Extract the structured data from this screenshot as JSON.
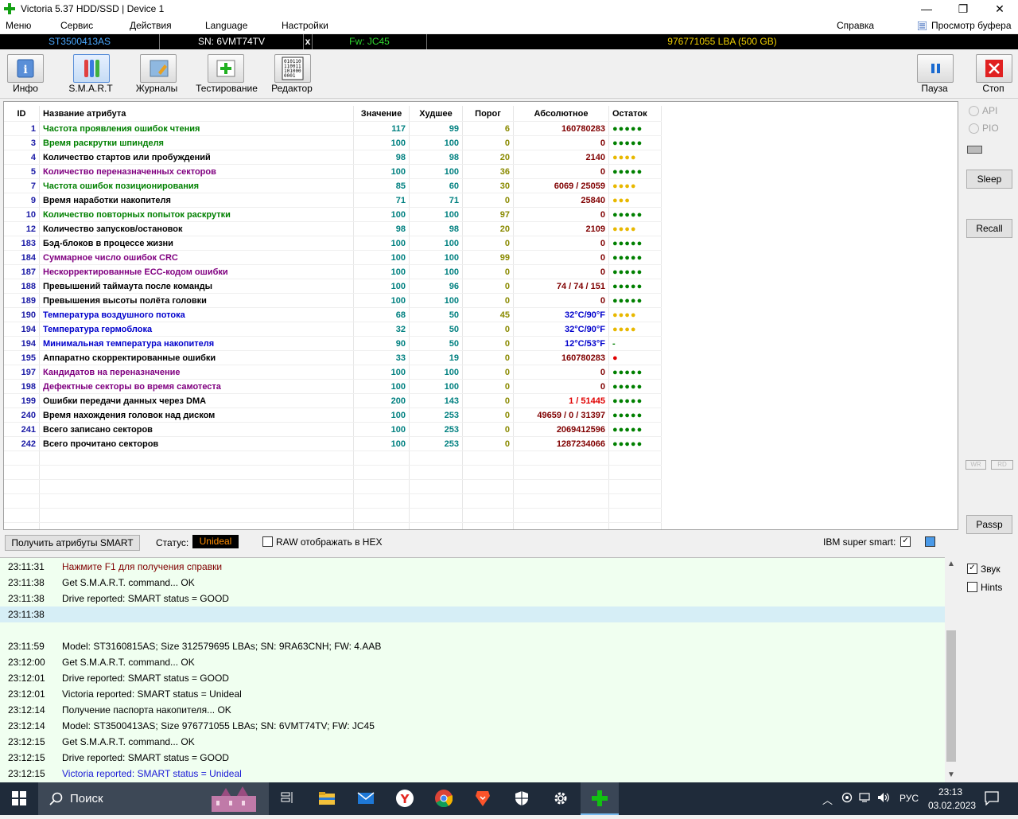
{
  "window": {
    "title": "Victoria 5.37 HDD/SSD | Device 1",
    "minimize": "—",
    "maximize": "❐",
    "close": "✕"
  },
  "menu": {
    "items": [
      "Меню",
      "Сервис",
      "Действия",
      "Language",
      "Настройки"
    ],
    "help": "Справка",
    "buffer": "Просмотр буфера"
  },
  "drive": {
    "model": "ST3500413AS",
    "serial": "SN: 6VMT74TV",
    "close": "x",
    "firmware": "Fw: JC45",
    "capacity": "976771055 LBA (500 GB)"
  },
  "toolbar": {
    "info": "Инфо",
    "smart": "S.M.A.R.T",
    "logs": "Журналы",
    "test": "Тестирование",
    "editor": "Редактор",
    "pause": "Пауза",
    "stop": "Стоп"
  },
  "table": {
    "headers": {
      "id": "ID",
      "name": "Название атрибута",
      "value": "Значение",
      "worst": "Худшее",
      "threshold": "Порог",
      "raw": "Абсолютное",
      "remain": "Остаток"
    },
    "rows": [
      {
        "id": "1",
        "name": "Частота проявления ошибок чтения",
        "value": "117",
        "worst": "99",
        "threshold": "6",
        "raw": "160780283",
        "remain": "●●●●●",
        "nameColor": "#008000",
        "remainColor": "#008000"
      },
      {
        "id": "3",
        "name": "Время раскрутки шпинделя",
        "value": "100",
        "worst": "100",
        "threshold": "0",
        "raw": "0",
        "remain": "●●●●●",
        "nameColor": "#008000",
        "remainColor": "#008000"
      },
      {
        "id": "4",
        "name": "Количество стартов или пробуждений",
        "value": "98",
        "worst": "98",
        "threshold": "20",
        "raw": "2140",
        "remain": "●●●●",
        "nameColor": "#000000",
        "remainColor": "#e8b800"
      },
      {
        "id": "5",
        "name": "Количество переназначенных секторов",
        "value": "100",
        "worst": "100",
        "threshold": "36",
        "raw": "0",
        "remain": "●●●●●",
        "nameColor": "#800080",
        "remainColor": "#008000"
      },
      {
        "id": "7",
        "name": "Частота ошибок позиционирования",
        "value": "85",
        "worst": "60",
        "threshold": "30",
        "raw": "6069 / 25059",
        "remain": "●●●●",
        "nameColor": "#008000",
        "remainColor": "#e8b800"
      },
      {
        "id": "9",
        "name": "Время наработки накопителя",
        "value": "71",
        "worst": "71",
        "threshold": "0",
        "raw": "25840",
        "remain": "●●●",
        "nameColor": "#000000",
        "remainColor": "#e8b800"
      },
      {
        "id": "10",
        "name": "Количество повторных попыток раскрутки",
        "value": "100",
        "worst": "100",
        "threshold": "97",
        "raw": "0",
        "remain": "●●●●●",
        "nameColor": "#008000",
        "remainColor": "#008000"
      },
      {
        "id": "12",
        "name": "Количество запусков/остановок",
        "value": "98",
        "worst": "98",
        "threshold": "20",
        "raw": "2109",
        "remain": "●●●●",
        "nameColor": "#000000",
        "remainColor": "#e8b800"
      },
      {
        "id": "183",
        "name": "Бэд-блоков в процессе жизни",
        "value": "100",
        "worst": "100",
        "threshold": "0",
        "raw": "0",
        "remain": "●●●●●",
        "nameColor": "#000000",
        "remainColor": "#008000"
      },
      {
        "id": "184",
        "name": "Суммарное число ошибок CRC",
        "value": "100",
        "worst": "100",
        "threshold": "99",
        "raw": "0",
        "remain": "●●●●●",
        "nameColor": "#800080",
        "remainColor": "#008000"
      },
      {
        "id": "187",
        "name": "Нескорректированные ECC-кодом ошибки",
        "value": "100",
        "worst": "100",
        "threshold": "0",
        "raw": "0",
        "remain": "●●●●●",
        "nameColor": "#800080",
        "remainColor": "#008000"
      },
      {
        "id": "188",
        "name": "Превышений таймаута после команды",
        "value": "100",
        "worst": "96",
        "threshold": "0",
        "raw": "74 / 74 / 151",
        "remain": "●●●●●",
        "nameColor": "#000000",
        "remainColor": "#008000"
      },
      {
        "id": "189",
        "name": "Превышения высоты полёта головки",
        "value": "100",
        "worst": "100",
        "threshold": "0",
        "raw": "0",
        "remain": "●●●●●",
        "nameColor": "#000000",
        "remainColor": "#008000"
      },
      {
        "id": "190",
        "name": "Температура воздушного потока",
        "value": "68",
        "worst": "50",
        "threshold": "45",
        "raw": "32°C/90°F",
        "remain": "●●●●",
        "nameColor": "#0000cc",
        "remainColor": "#e8b800",
        "rawColor": "#0000cc"
      },
      {
        "id": "194",
        "name": "Температура гермоблока",
        "value": "32",
        "worst": "50",
        "threshold": "0",
        "raw": "32°C/90°F",
        "remain": "●●●●",
        "nameColor": "#0000cc",
        "remainColor": "#e8b800",
        "rawColor": "#0000cc"
      },
      {
        "id": "194",
        "name": "Минимальная температура накопителя",
        "value": "90",
        "worst": "50",
        "threshold": "0",
        "raw": "12°C/53°F",
        "remain": "-",
        "nameColor": "#0000cc",
        "remainColor": "#008000",
        "rawColor": "#0000cc"
      },
      {
        "id": "195",
        "name": "Аппаратно скорректированные ошибки",
        "value": "33",
        "worst": "19",
        "threshold": "0",
        "raw": "160780283",
        "remain": "●",
        "nameColor": "#000000",
        "remainColor": "#e00000"
      },
      {
        "id": "197",
        "name": "Кандидатов на переназначение",
        "value": "100",
        "worst": "100",
        "threshold": "0",
        "raw": "0",
        "remain": "●●●●●",
        "nameColor": "#800080",
        "remainColor": "#008000"
      },
      {
        "id": "198",
        "name": "Дефектные секторы во время самотеста",
        "value": "100",
        "worst": "100",
        "threshold": "0",
        "raw": "0",
        "remain": "●●●●●",
        "nameColor": "#800080",
        "remainColor": "#008000"
      },
      {
        "id": "199",
        "name": "Ошибки передачи данных через DMA",
        "value": "200",
        "worst": "143",
        "threshold": "0",
        "raw": "1 / 51445",
        "remain": "●●●●●",
        "nameColor": "#000000",
        "remainColor": "#008000",
        "rawColor": "#e00000"
      },
      {
        "id": "240",
        "name": "Время нахождения головок над диском",
        "value": "100",
        "worst": "253",
        "threshold": "0",
        "raw": "49659 / 0 / 31397",
        "remain": "●●●●●",
        "nameColor": "#000000",
        "remainColor": "#008000"
      },
      {
        "id": "241",
        "name": "Всего записано секторов",
        "value": "100",
        "worst": "253",
        "threshold": "0",
        "raw": "2069412596",
        "remain": "●●●●●",
        "nameColor": "#000000",
        "remainColor": "#008000"
      },
      {
        "id": "242",
        "name": "Всего прочитано секторов",
        "value": "100",
        "worst": "253",
        "threshold": "0",
        "raw": "1287234066",
        "remain": "●●●●●",
        "nameColor": "#000000",
        "remainColor": "#008000"
      }
    ]
  },
  "rightpanel": {
    "api": "API",
    "pio": "PIO",
    "sleep": "Sleep",
    "recall": "Recall",
    "wr": "WR",
    "rd": "RD",
    "passp": "Passp",
    "sound": "Звук",
    "hints": "Hints"
  },
  "smartbar": {
    "get_button": "Получить атрибуты SMART",
    "status_label": "Статус:",
    "status_value": "Unideal",
    "raw_hex": "RAW отображать в HEX",
    "ibm": "IBM super smart:"
  },
  "log": [
    {
      "t": "23:11:31",
      "m": "Нажмите F1 для получения справки",
      "color": "#800000"
    },
    {
      "t": "23:11:38",
      "m": "Get S.M.A.R.T. command... OK",
      "color": "#000000"
    },
    {
      "t": "23:11:38",
      "m": "Drive reported: SMART status = GOOD",
      "color": "#000000"
    },
    {
      "t": "23:11:38",
      "m": "",
      "color": "#000000",
      "hl": true
    },
    {
      "t": "",
      "m": "",
      "color": "#000000"
    },
    {
      "t": "23:11:59",
      "m": "Model: ST3160815AS; Size 312579695 LBAs; SN: 9RA63CNH; FW: 4.AAB",
      "color": "#000000"
    },
    {
      "t": "23:12:00",
      "m": "Get S.M.A.R.T. command... OK",
      "color": "#000000"
    },
    {
      "t": "23:12:01",
      "m": "Drive reported: SMART status = GOOD",
      "color": "#000000"
    },
    {
      "t": "23:12:01",
      "m": "Victoria reported: SMART status = Unideal",
      "color": "#000000"
    },
    {
      "t": "23:12:14",
      "m": "Получение паспорта накопителя... OK",
      "color": "#000000"
    },
    {
      "t": "23:12:14",
      "m": "Model: ST3500413AS; Size 976771055 LBAs; SN: 6VMT74TV; FW: JC45",
      "color": "#000000"
    },
    {
      "t": "23:12:15",
      "m": "Get S.M.A.R.T. command... OK",
      "color": "#000000"
    },
    {
      "t": "23:12:15",
      "m": "Drive reported: SMART status = GOOD",
      "color": "#000000"
    },
    {
      "t": "23:12:15",
      "m": "Victoria reported: SMART status = Unideal",
      "color": "#1a1ad6"
    }
  ],
  "taskbar": {
    "search": "Поиск",
    "lang": "РУС",
    "time": "23:13",
    "date": "03.02.2023"
  }
}
